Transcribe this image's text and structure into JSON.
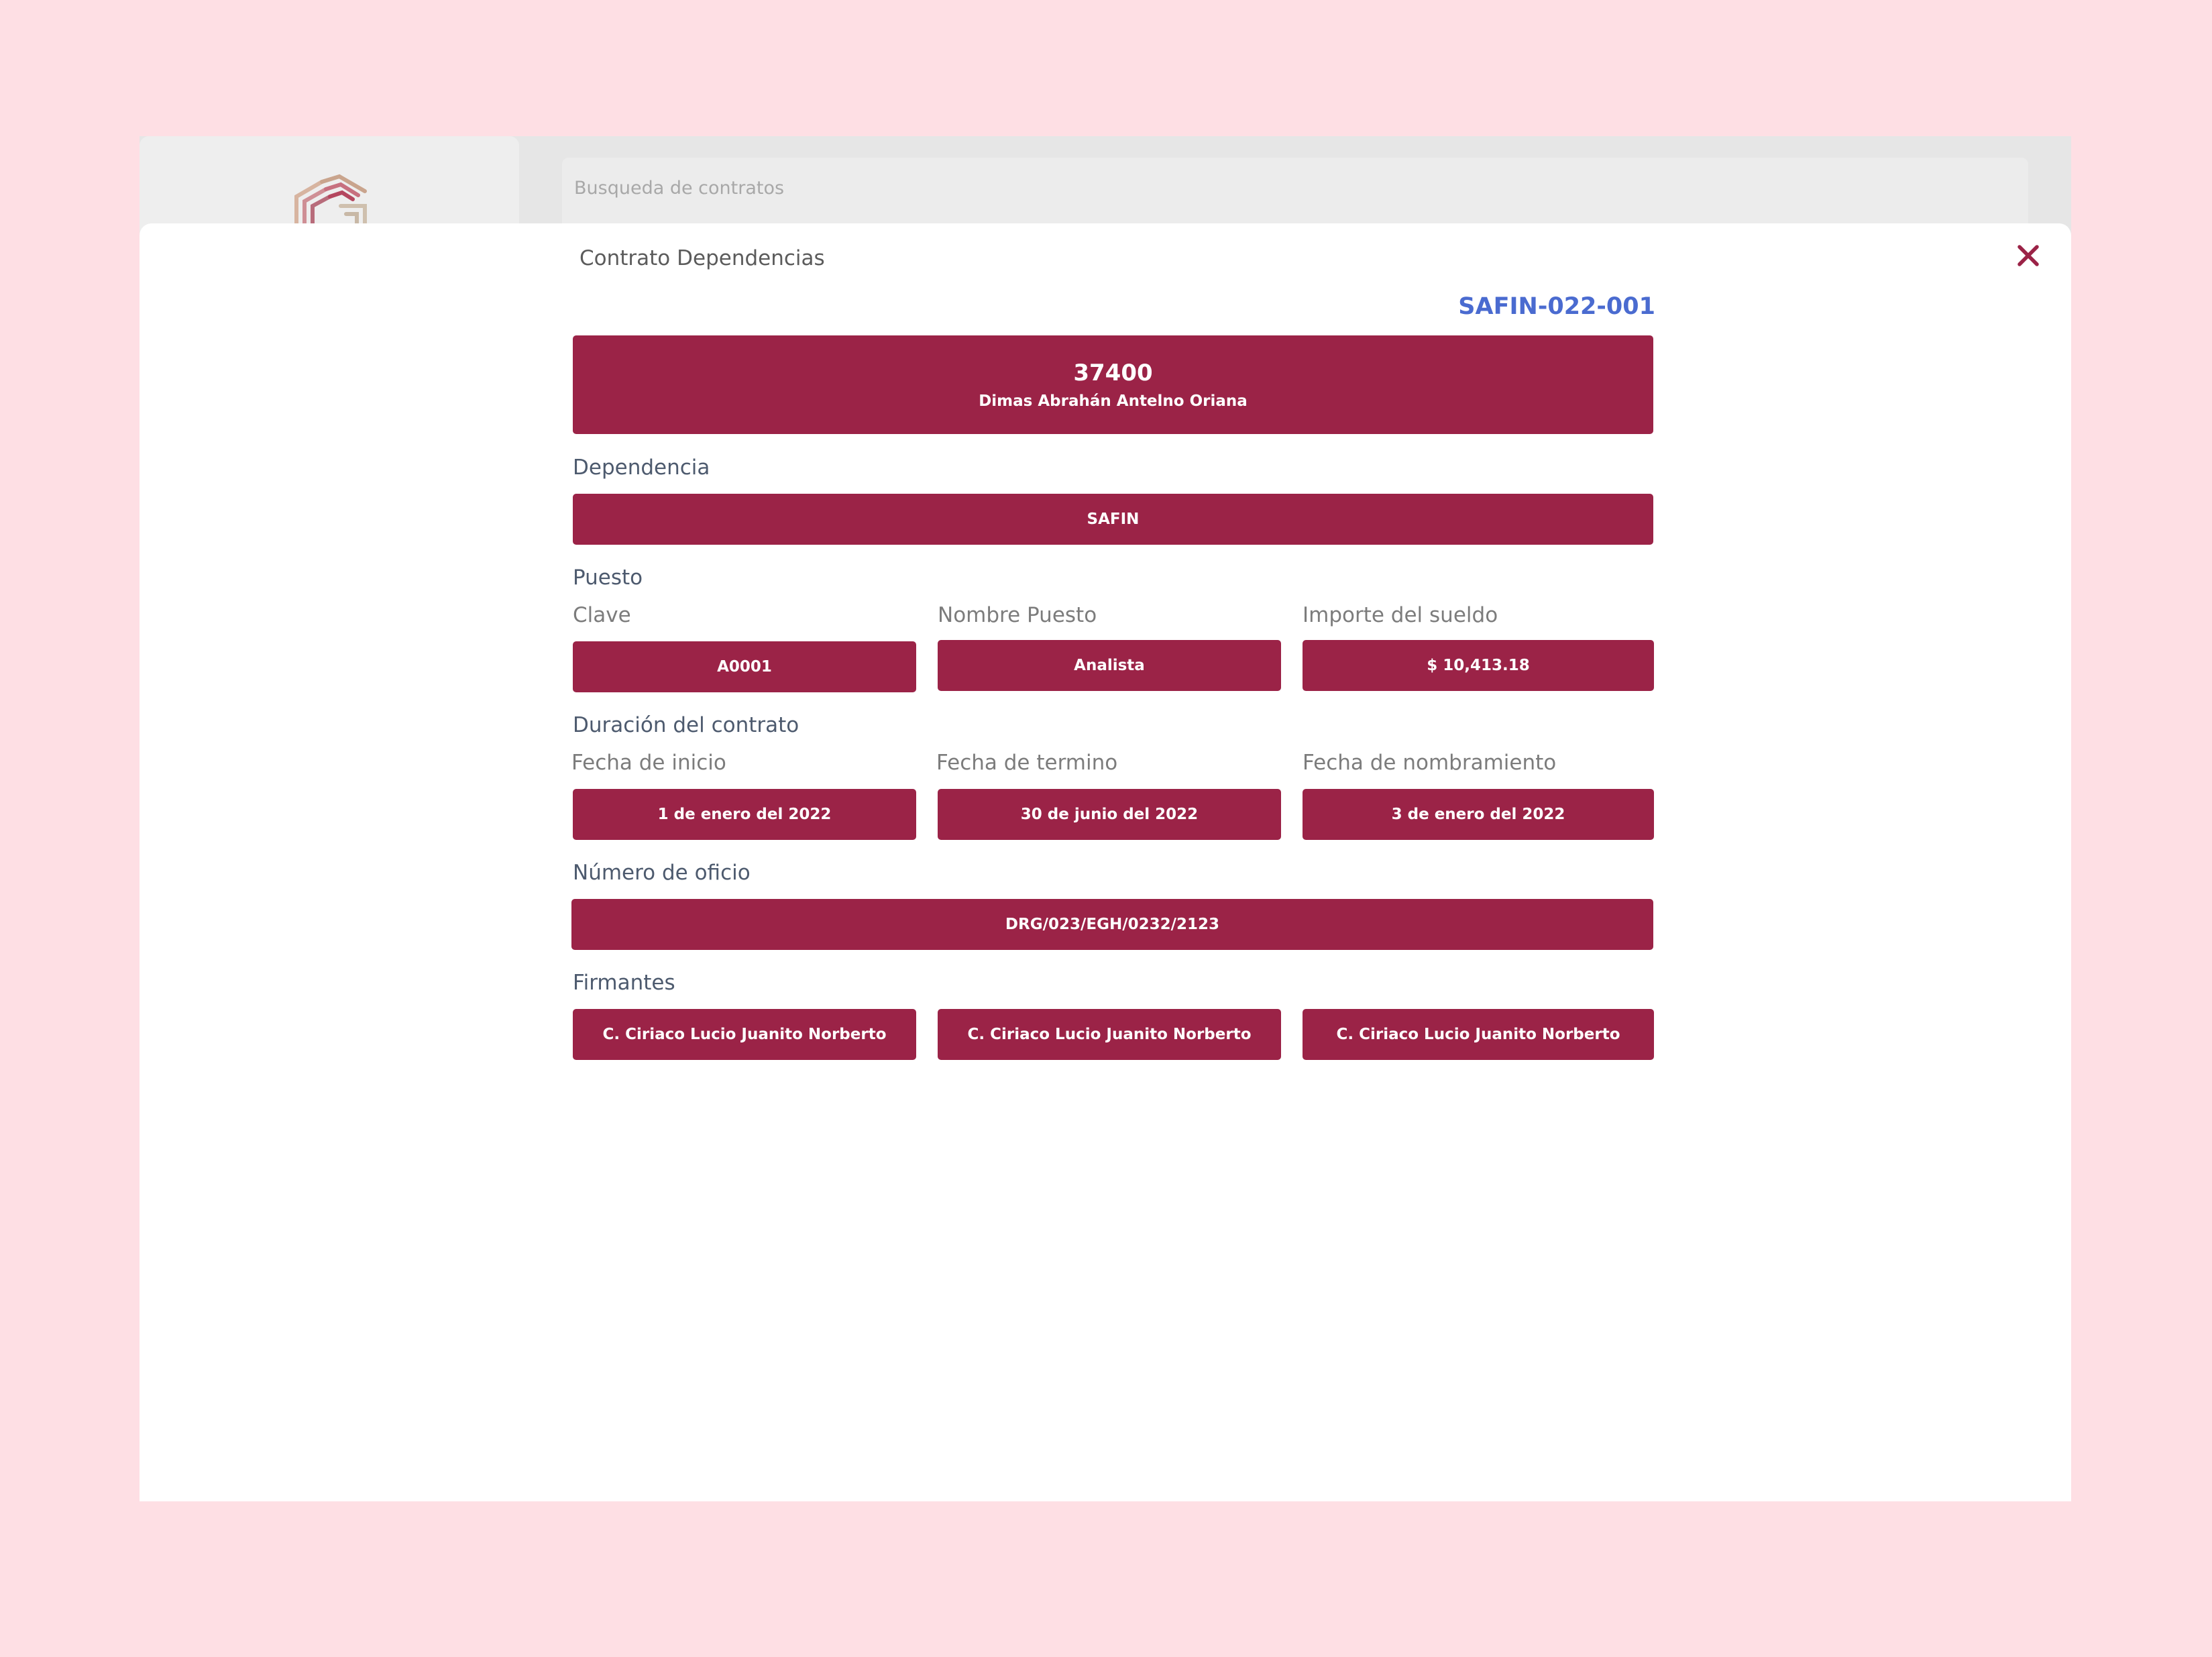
{
  "search": {
    "placeholder": "Busqueda de contratos"
  },
  "modal": {
    "title": "Contrato Dependencias",
    "contract_id": "SAFIN-022-001",
    "header": {
      "number": "37400",
      "name": "Dimas Abrahán Antelno Oriana"
    },
    "dependencia": {
      "label": "Dependencia",
      "value": "SAFIN"
    },
    "puesto": {
      "label": "Puesto",
      "clave_label": "Clave",
      "clave_value": "A0001",
      "nombre_label": "Nombre Puesto",
      "nombre_value": "Analista",
      "importe_label": "Importe del sueldo",
      "importe_value": "$ 10,413.18"
    },
    "duracion": {
      "label": "Duración del contrato",
      "inicio_label": "Fecha de inicio",
      "inicio_value": "1 de enero del 2022",
      "termino_label": "Fecha de termino",
      "termino_value": "30 de junio del 2022",
      "nombramiento_label": "Fecha de nombramiento",
      "nombramiento_value": "3 de enero del 2022"
    },
    "oficio": {
      "label": "Número de oficio",
      "value": "DRG/023/EGH/0232/2123"
    },
    "firmantes": {
      "label": "Firmantes",
      "items": [
        "C. Ciriaco Lucio Juanito Norberto",
        "C. Ciriaco Lucio Juanito Norberto",
        "C. Ciriaco Lucio Juanito Norberto"
      ]
    }
  },
  "colors": {
    "background": "#fedfe4",
    "accent": "#9b2347",
    "contract_id": "#4a6bd0",
    "section_label": "#4d5a6e"
  },
  "icons": {
    "logo": "hexagon-logo-icon",
    "close": "close-icon"
  }
}
